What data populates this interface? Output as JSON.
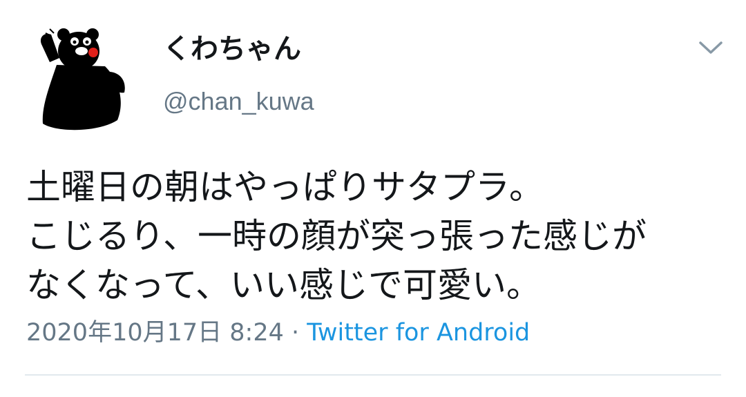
{
  "user": {
    "display_name": "くわちゃん",
    "handle": "@chan_kuwa",
    "avatar_icon": "bear-mascot-icon"
  },
  "tweet": {
    "lines": [
      "土曜日の朝はやっぱりサタプラ。",
      "こじるり、一時の顔が突っ張った感じが",
      "なくなって、いい感じで可愛い。"
    ],
    "timestamp": "2020年10月17日 8:24",
    "separator": " · ",
    "source": "Twitter for Android"
  },
  "menu": {
    "icon": "chevron-down-icon"
  },
  "colors": {
    "text": "#14171a",
    "secondary": "#657786",
    "link": "#1b95e0",
    "divider": "#e1e8ed"
  }
}
